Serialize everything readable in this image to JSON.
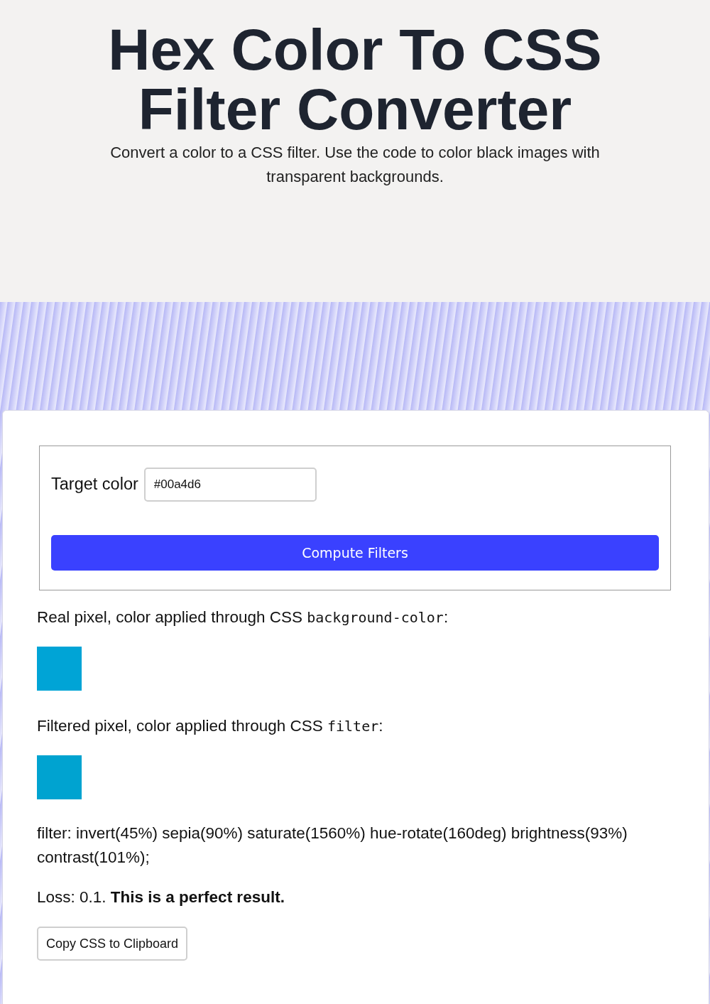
{
  "header": {
    "title": "Hex Color To CSS Filter Converter",
    "subtitle": "Convert a color to a CSS filter. Use the code to color black images with transparent backgrounds."
  },
  "form": {
    "label": "Target color",
    "value": "#00a4d6",
    "button": "Compute Filters"
  },
  "previews": [
    {
      "text": "Real pixel, color applied through CSS ",
      "code": "background-color",
      "after": ":",
      "color": "#00a4d6"
    },
    {
      "text": "Filtered pixel, color applied through CSS ",
      "code": "filter",
      "after": ":",
      "color": "#00a3d0"
    }
  ],
  "result": {
    "filter": "filter: invert(45%) sepia(90%) saturate(1560%) hue-rotate(160deg) brightness(93%) contrast(101%);",
    "loss": "Loss: 0.1. **This is a perfect result.**",
    "copy_button": "Copy CSS to Clipboard"
  }
}
